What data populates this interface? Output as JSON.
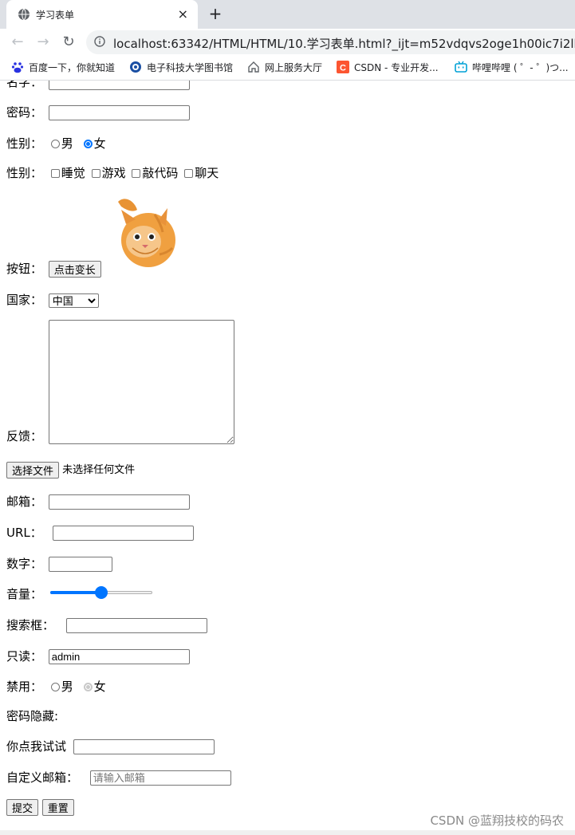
{
  "browser": {
    "tab_title": "学习表单",
    "tab_close": "×",
    "new_tab": "+",
    "back": "←",
    "forward": "→",
    "reload": "↻",
    "url": "localhost:63342/HTML/HTML/10.学习表单.html?_ijt=m52vdqvs2oge1h00ic7i2lhs7g",
    "bookmarks": [
      {
        "label": "百度一下，你就知道",
        "icon": "baidu-icon"
      },
      {
        "label": "电子科技大学图书馆",
        "icon": "library-icon"
      },
      {
        "label": "网上服务大厅",
        "icon": "home-icon"
      },
      {
        "label": "CSDN - 专业开发...",
        "icon": "csdn-icon"
      },
      {
        "label": "哔哩哔哩 ( ゜- ゜)つ...",
        "icon": "bilibili-icon"
      }
    ]
  },
  "form": {
    "username_label": "名字：",
    "password_label": "密码：",
    "gender_label": "性别：",
    "gender_male": "男",
    "gender_female": "女",
    "hobby_label": "性别：",
    "hobbies": [
      "睡觉",
      "游戏",
      "敲代码",
      "聊天"
    ],
    "button_label": "按钮：",
    "button_text": "点击变长",
    "country_label": "国家：",
    "country_selected": "中国",
    "feedback_label": "反馈：",
    "file_button": "选择文件",
    "file_status": "未选择任何文件",
    "email_label": "邮箱：",
    "url_label": "URL：",
    "number_label": "数字：",
    "volume_label": "音量：",
    "volume_value": 0.5,
    "search_label": "搜索框：",
    "readonly_label": "只读：",
    "readonly_value": "admin",
    "disabled_label": "禁用：",
    "disabled_male": "男",
    "disabled_female": "女",
    "hidden_label": "密码隐藏:",
    "clickme_label": "你点我试试",
    "custom_email_label": "自定义邮箱：",
    "custom_email_placeholder": "请输入邮箱",
    "submit": "提交",
    "reset": "重置"
  },
  "watermark": "CSDN @蓝翔技校的码农",
  "colors": {
    "accent": "#0075ff",
    "tabbar": "#dee1e6"
  }
}
